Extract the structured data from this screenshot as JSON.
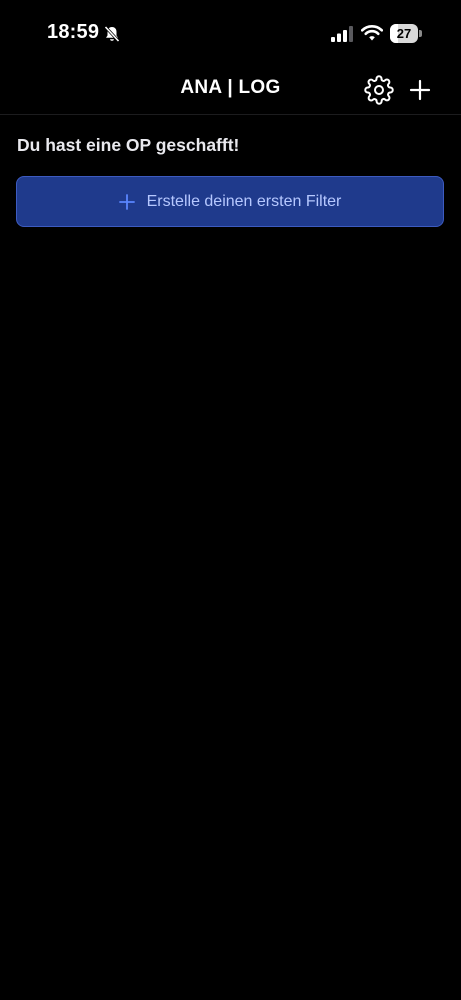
{
  "status_bar": {
    "time": "18:59",
    "battery_level": "27",
    "icons": [
      "bell-slash-icon",
      "cellular-signal-icon",
      "wifi-icon",
      "battery-icon"
    ]
  },
  "nav": {
    "title": "ANA | LOG",
    "icons": [
      "gear-icon",
      "plus-icon"
    ]
  },
  "main": {
    "message": "Du hast eine OP geschafft!",
    "filter_button_label": "Erstelle deinen ersten Filter"
  },
  "colors": {
    "background": "#000000",
    "button_fill": "#1f3a8c",
    "button_border": "#3d5bc0",
    "button_text": "#b6c8ff",
    "button_icon": "#5a86ff"
  }
}
